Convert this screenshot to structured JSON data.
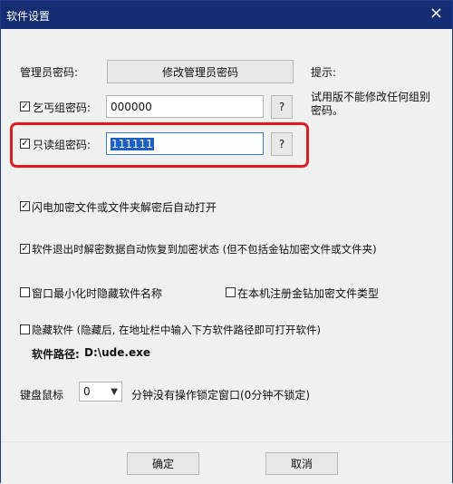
{
  "window": {
    "title": "软件设置",
    "close_icon": "×"
  },
  "admin": {
    "label": "管理员密码:",
    "button": "修改管理员密码"
  },
  "hint": {
    "label": "提示:",
    "text_line1": "试用版不能修改任何组别",
    "text_line2": "密码。"
  },
  "beggar": {
    "label": "乞丐组密码:",
    "value": "000000",
    "help": "?",
    "checked": true
  },
  "readonly": {
    "label": "只读组密码:",
    "value": "111111",
    "help": "?",
    "checked": true
  },
  "options": {
    "flash_open": {
      "label": "闪电加密文件或文件夹解密后自动打开",
      "checked": true
    },
    "auto_restore": {
      "label": "软件退出时解密数据自动恢复到加密状态 (但不包括金钻加密文件或文件夹)",
      "checked": true
    },
    "hide_name": {
      "label": "窗口最小化时隐藏软件名称",
      "checked": false
    },
    "register_type": {
      "label": "在本机注册金钻加密文件类型",
      "checked": false
    },
    "hide_software": {
      "label": "隐藏软件 (隐藏后, 在地址栏中输入下方软件路径即可打开软件)",
      "checked": false
    }
  },
  "path": {
    "label": "软件路径:",
    "value": "D:\\ude.exe"
  },
  "lock": {
    "label": "键盘鼠标",
    "value": "0",
    "suffix": "分钟没有操作锁定窗口(0分钟不锁定)"
  },
  "footer": {
    "ok": "确定",
    "cancel": "取消"
  }
}
